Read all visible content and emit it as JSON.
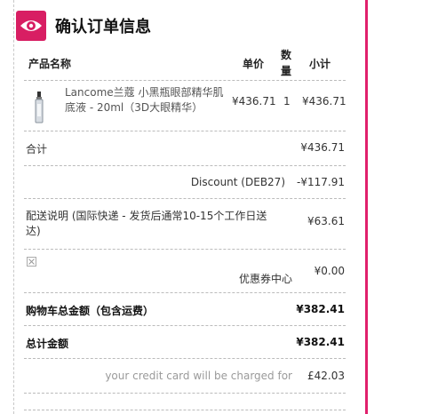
{
  "header": {
    "title": "确认订单信息"
  },
  "table": {
    "col_product": "产品名称",
    "col_unit_price": "单价",
    "col_qty_line1": "数",
    "col_qty_line2": "量",
    "col_subtotal": "小计"
  },
  "product": {
    "name_line1": "Lancome兰蔻 小黑瓶眼部精华肌",
    "name_line2": "底液 - 20ml（3D大眼精华）",
    "unit_price": "¥436.71",
    "quantity": "1",
    "subtotal": "¥436.71"
  },
  "summary": {
    "total_label": "合计",
    "total_value": "¥436.71",
    "discount_label": "Discount (DEB27)",
    "discount_value": "-¥117.91",
    "shipping_label_line1": "配送说明 (国际快递 - 发货后通常10-15个工作日送",
    "shipping_label_line2": "达)",
    "shipping_value": "¥63.61",
    "coupon_label": "优惠券中心",
    "coupon_value": "¥0.00",
    "cart_total_label": "购物车总金额（包含运费）",
    "cart_total_value": "¥382.41",
    "grand_total_label": "总计金额",
    "grand_total_value": "¥382.41",
    "charged_label": "your credit card will be charged for",
    "charged_value": "£42.03"
  }
}
